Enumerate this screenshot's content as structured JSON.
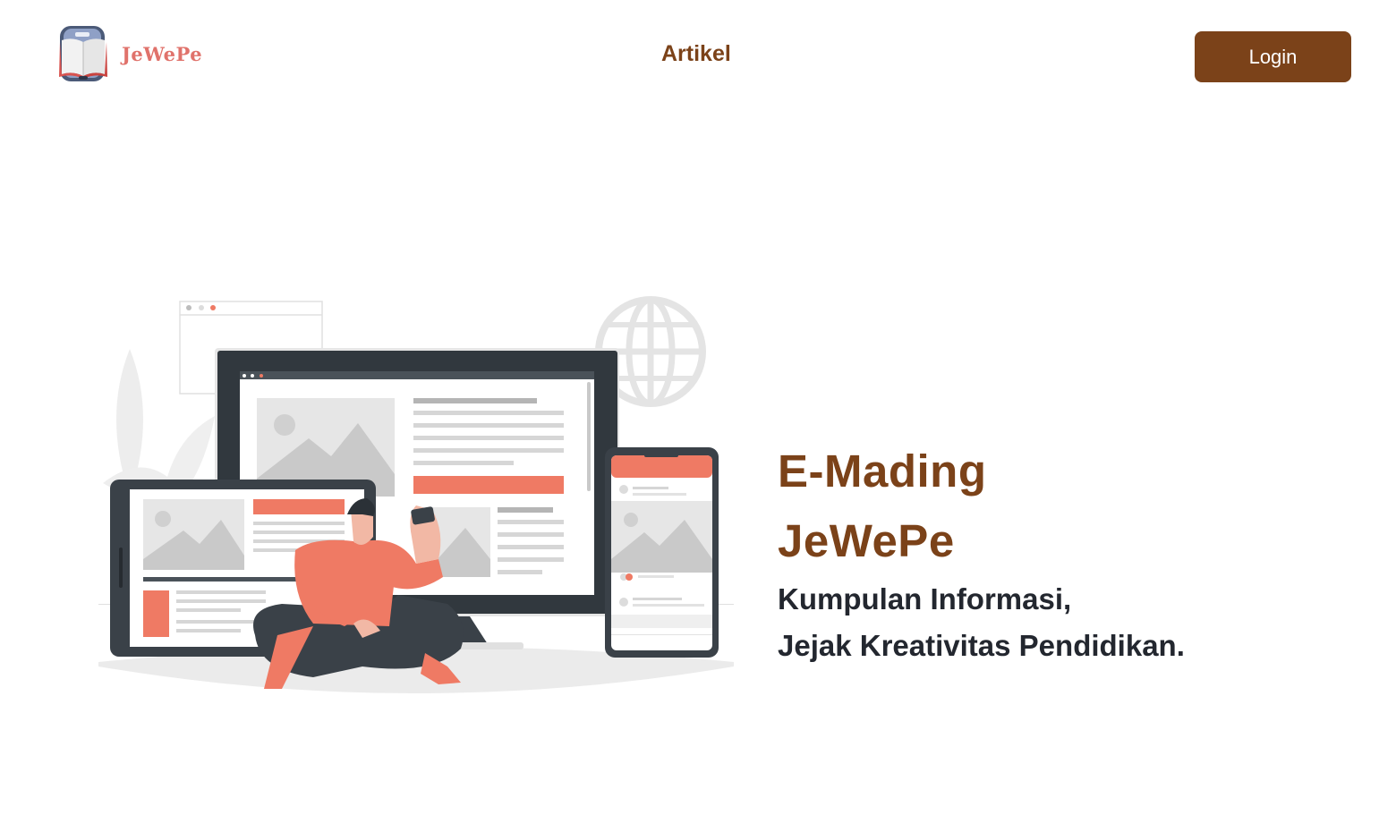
{
  "brand": {
    "name": "JeWePe",
    "logo_icon": "book-logo-icon"
  },
  "nav": {
    "link_label": "Artikel"
  },
  "header": {
    "login_label": "Login"
  },
  "hero": {
    "title_line1": "E-Mading",
    "title_line2": "JeWePe",
    "subtitle_line1": "Kumpulan Informasi,",
    "subtitle_line2": "Jejak Kreativitas Pendidikan.",
    "illustration": "person-with-devices-illustration"
  },
  "colors": {
    "brand_brown": "#7b4219",
    "accent_coral": "#ef7a64",
    "dark_text": "#23272f",
    "device_frame": "#3a4148"
  }
}
